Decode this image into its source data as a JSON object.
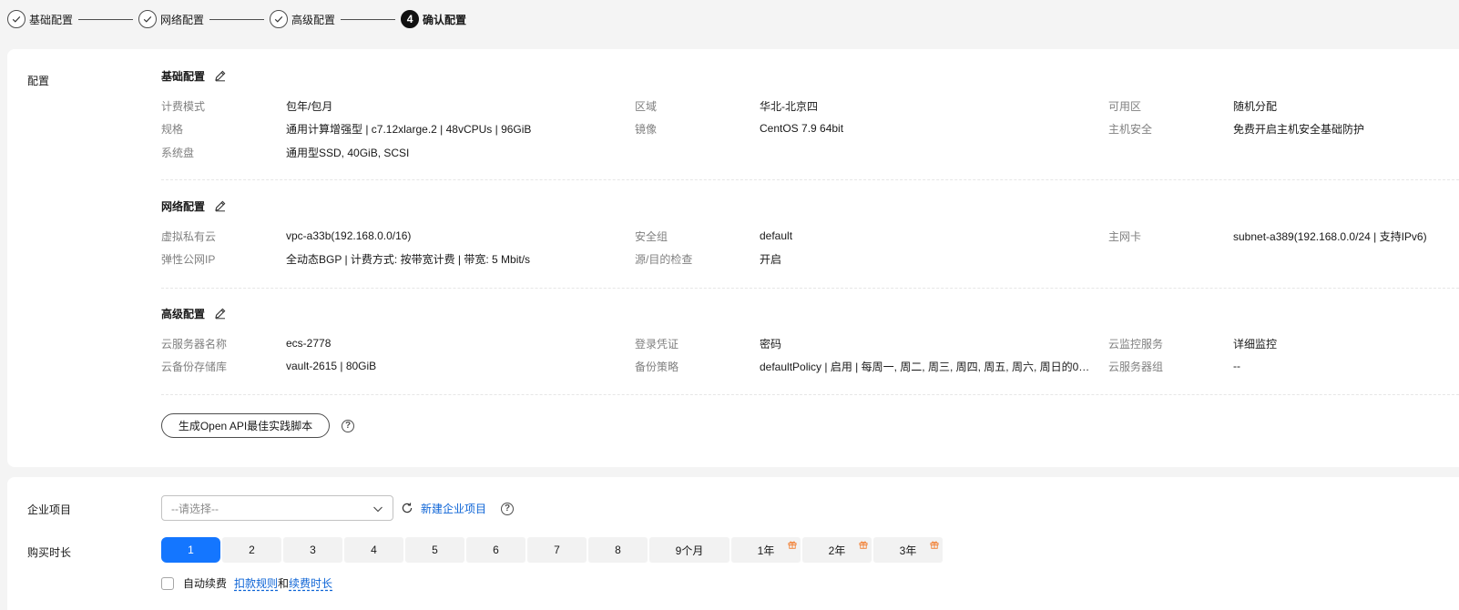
{
  "steps": [
    {
      "label": "基础配置",
      "state": "done"
    },
    {
      "label": "网络配置",
      "state": "done"
    },
    {
      "label": "高级配置",
      "state": "done"
    },
    {
      "label": "确认配置",
      "state": "active",
      "num": "4"
    }
  ],
  "config": {
    "side_label": "配置",
    "basic": {
      "title": "基础配置",
      "rows": [
        [
          [
            "计费模式",
            "包年/包月"
          ],
          [
            "区域",
            "华北-北京四"
          ],
          [
            "可用区",
            "随机分配"
          ]
        ],
        [
          [
            "规格",
            "通用计算增强型 | c7.12xlarge.2 | 48vCPUs | 96GiB"
          ],
          [
            "镜像",
            "CentOS 7.9 64bit"
          ],
          [
            "主机安全",
            "免费开启主机安全基础防护"
          ]
        ],
        [
          [
            "系统盘",
            "通用型SSD, 40GiB, SCSI"
          ]
        ]
      ]
    },
    "network": {
      "title": "网络配置",
      "rows": [
        [
          [
            "虚拟私有云",
            "vpc-a33b(192.168.0.0/16)"
          ],
          [
            "安全组",
            "default"
          ],
          [
            "主网卡",
            "subnet-a389(192.168.0.0/24 | 支持IPv6)"
          ]
        ],
        [
          [
            "弹性公网IP",
            "全动态BGP | 计费方式: 按带宽计费 | 带宽: 5 Mbit/s"
          ],
          [
            "源/目的检查",
            "开启"
          ]
        ]
      ]
    },
    "advanced": {
      "title": "高级配置",
      "rows": [
        [
          [
            "云服务器名称",
            "ecs-2778"
          ],
          [
            "登录凭证",
            "密码"
          ],
          [
            "云监控服务",
            "详细监控"
          ]
        ],
        [
          [
            "云备份存储库",
            "vault-2615 | 80GiB"
          ],
          [
            "备份策略",
            "defaultPolicy | 启用 | 每周一, 周二, 周三, 周四, 周五, 周六, 周日的00..."
          ],
          [
            "云服务器组",
            "--"
          ]
        ]
      ]
    },
    "api_button": "生成Open API最佳实践脚本"
  },
  "purchase": {
    "enterprise_label": "企业项目",
    "select_placeholder": "--请选择--",
    "new_project_link": "新建企业项目",
    "duration_label": "购买时长",
    "durations": [
      {
        "label": "1",
        "active": true,
        "gift": false
      },
      {
        "label": "2",
        "gift": false
      },
      {
        "label": "3",
        "gift": false
      },
      {
        "label": "4",
        "gift": false
      },
      {
        "label": "5",
        "gift": false
      },
      {
        "label": "6",
        "gift": false
      },
      {
        "label": "7",
        "gift": false
      },
      {
        "label": "8",
        "gift": false
      },
      {
        "label": "9个月",
        "gift": false
      },
      {
        "label": "1年",
        "gift": true
      },
      {
        "label": "2年",
        "gift": true
      },
      {
        "label": "3年",
        "gift": true
      }
    ],
    "auto_renew_label": "自动续费",
    "rule_link": "扣款规则",
    "and_text": "和",
    "renew_duration_link": "续费时长"
  },
  "colors": {
    "accent": "#1476ff",
    "link": "#0d64d6",
    "gift": "#f27c2d"
  }
}
